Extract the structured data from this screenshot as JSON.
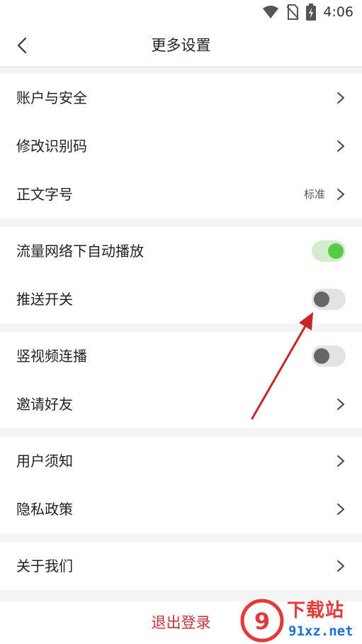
{
  "status_bar": {
    "time": "4:06",
    "icons": [
      "wifi-icon",
      "no-sim-icon",
      "battery-charging-icon"
    ]
  },
  "header": {
    "title": "更多设置",
    "back_icon": "chevron-left-icon"
  },
  "groups": [
    {
      "items": [
        {
          "label": "账户与安全",
          "type": "link"
        },
        {
          "label": "修改识别码",
          "type": "link"
        },
        {
          "label": "正文字号",
          "type": "link",
          "value": "标准"
        }
      ]
    },
    {
      "items": [
        {
          "label": "流量网络下自动播放",
          "type": "toggle",
          "on": true
        },
        {
          "label": "推送开关",
          "type": "toggle",
          "on": false
        }
      ]
    },
    {
      "items": [
        {
          "label": "竖视频连播",
          "type": "toggle",
          "on": false
        },
        {
          "label": "邀请好友",
          "type": "link"
        }
      ]
    },
    {
      "items": [
        {
          "label": "用户须知",
          "type": "link"
        },
        {
          "label": "隐私政策",
          "type": "link"
        }
      ]
    },
    {
      "items": [
        {
          "label": "关于我们",
          "type": "link"
        }
      ]
    }
  ],
  "logout": {
    "label": "退出登录"
  },
  "watermark": {
    "title": "下载站",
    "url": "91xz.net"
  },
  "colors": {
    "accent_red": "#c0343b",
    "toggle_on": "#59c948",
    "toggle_off_knob": "#666666",
    "arrow": "#c62828"
  }
}
